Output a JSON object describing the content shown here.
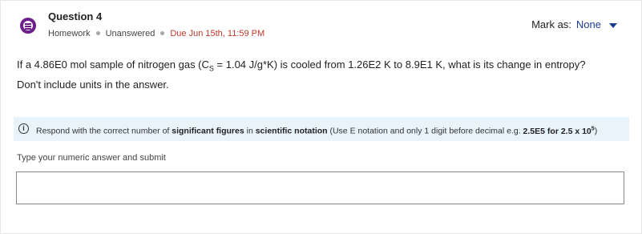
{
  "header": {
    "title": "Question 4",
    "type": "Homework",
    "status": "Unanswered",
    "due": "Due Jun 15th, 11:59 PM"
  },
  "mark_as": {
    "label": "Mark as:",
    "value": "None"
  },
  "question": {
    "part1": "If a 4.86E0 mol sample of nitrogen gas (C",
    "sub": "S",
    "part2": " = 1.04 J/g*K) is cooled from 1.26E2 K to 8.9E1 K, what is its change in entropy? Don't include units in the answer."
  },
  "info": {
    "text1": "Respond with the correct number of ",
    "bold1": "significant figures",
    "text2": " in ",
    "bold2": "scientific notation",
    "text3": " (Use E notation and only 1 digit before decimal e.g. ",
    "bold3": "2.5E5 for 2.5 x 10",
    "sup": "5",
    "text4": ")"
  },
  "answer": {
    "prompt": "Type your numeric answer and submit",
    "value": ""
  },
  "colors": {
    "accent": "#6d1f8c",
    "due": "#c0392b",
    "link": "#1a3e8f",
    "info_bg": "#e8f3fc"
  }
}
